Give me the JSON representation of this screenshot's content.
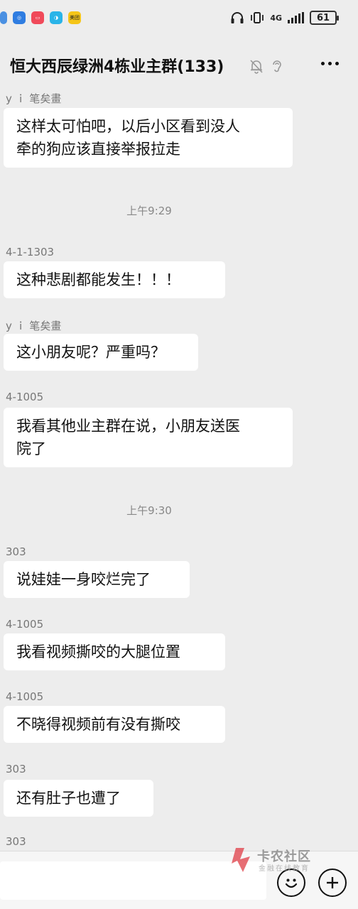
{
  "status_bar": {
    "network": "4G",
    "battery": "61"
  },
  "chat": {
    "title": "恒大西辰绿洲4栋业主群(133)"
  },
  "messages": [
    {
      "sender": "y ｉ 笔矣畫",
      "lines": [
        "这样太可怕吧，以后小区看到没人",
        "牵的狗应该直接举报拉走"
      ]
    },
    {
      "timestamp": "上午9:29"
    },
    {
      "sender": "4-1-1303",
      "lines": [
        "这种悲剧都能发生！！！"
      ]
    },
    {
      "sender": "y ｉ 笔矣畫",
      "lines": [
        "这小朋友呢？严重吗？"
      ]
    },
    {
      "sender": "4-1005",
      "lines": [
        "我看其他业主群在说，小朋友送医",
        "院了"
      ]
    },
    {
      "timestamp": "上午9:30"
    },
    {
      "sender": "303",
      "lines": [
        "说娃娃一身咬烂完了"
      ]
    },
    {
      "sender": "4-1005",
      "lines": [
        "我看视频撕咬的大腿位置"
      ]
    },
    {
      "sender": "4-1005",
      "lines": [
        "不晓得视频前有没有撕咬"
      ]
    },
    {
      "sender": "303",
      "lines": [
        "还有肚子也遭了"
      ]
    },
    {
      "sender": "303"
    }
  ],
  "watermark": {
    "name": "卡农社区",
    "tagline": "金融在线教育"
  },
  "colors": {
    "background": "#ededed",
    "bubble": "#ffffff",
    "watermark_red": "#e0414a"
  }
}
